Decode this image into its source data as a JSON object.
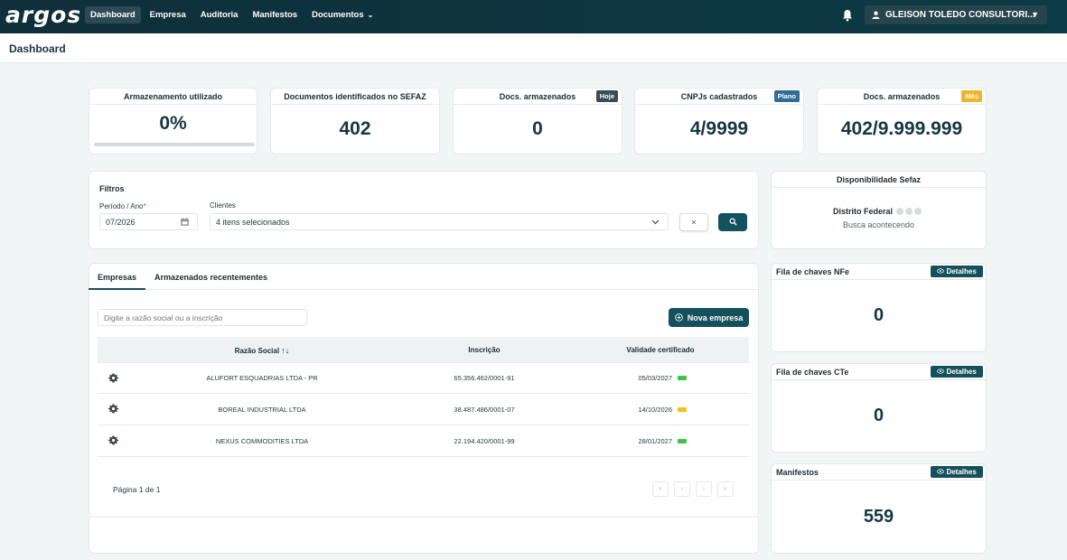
{
  "app": {
    "logo": "argos"
  },
  "nav": {
    "items": [
      {
        "label": "Dashboard"
      },
      {
        "label": "Empresa"
      },
      {
        "label": "Auditoria"
      },
      {
        "label": "Manifestos"
      },
      {
        "label": "Documentos"
      }
    ],
    "active": "Dashboard"
  },
  "user": {
    "name": "GLEISON TOLEDO CONSULTORI..."
  },
  "page": {
    "title": "Dashboard"
  },
  "stats": [
    {
      "title": "Armazenamento utilizado",
      "value": "0%",
      "progress": 0
    },
    {
      "title": "Documentos identificados no SEFAZ",
      "value": "402"
    },
    {
      "title": "Docs. armazenados",
      "value": "0",
      "badge": "Hoje",
      "badge_color": "#3c4a52"
    },
    {
      "title": "CNPJs cadastrados",
      "value": "4/9999",
      "badge": "Plano",
      "badge_color": "#2f6c97"
    },
    {
      "title": "Docs. armazenados",
      "value": "402/9.999.999",
      "badge": "Mês",
      "badge_color": "#f0b429"
    }
  ],
  "filters": {
    "title": "Filtros",
    "period_label": "Período / Ano",
    "required_mark": "*",
    "period_value": "07/2026",
    "clients_label": "Clientes",
    "clients_value": "4 itens selecionados",
    "clear_label": "×"
  },
  "sefaz": {
    "title": "Disponibilidade Sefaz",
    "region": "Distrito Federal",
    "status": "Busca acontecendo"
  },
  "tabs": [
    {
      "label": "Empresas"
    },
    {
      "label": "Armazenados recentementes"
    }
  ],
  "companies": {
    "search_placeholder": "Digite a razão social ou a inscrição",
    "new_button": "Nova empresa",
    "columns": {
      "name": "Razão Social",
      "sort_glyph": "↑↓",
      "registration": "Inscrição",
      "validity": "Validade certificado"
    },
    "rows": [
      {
        "name": "ALUFORT ESQUADRIAS LTDA - PR",
        "registration": "65.356.462/0001-91",
        "validity": "05/03/2027",
        "status_color": "#3fc24a"
      },
      {
        "name": "BOREAL INDUSTRIAL LTDA",
        "registration": "38.487.486/0001-07",
        "validity": "14/10/2026",
        "status_color": "#f0c419"
      },
      {
        "name": "NEXUS COMMODITIES LTDA",
        "registration": "22.194.420/0001-99",
        "validity": "28/01/2027",
        "status_color": "#3fc24a"
      }
    ],
    "pagination": {
      "label": "Página 1 de 1",
      "first": "«",
      "prev": "‹",
      "next": "›",
      "last": "»"
    }
  },
  "queues": [
    {
      "title": "Fila de chaves NFe",
      "button": "Detalhes",
      "value": "0"
    },
    {
      "title": "Fila de chaves CTe",
      "button": "Detalhes",
      "value": "0"
    },
    {
      "title": "Manifestos",
      "button": "Detalhes",
      "value": "559"
    }
  ]
}
